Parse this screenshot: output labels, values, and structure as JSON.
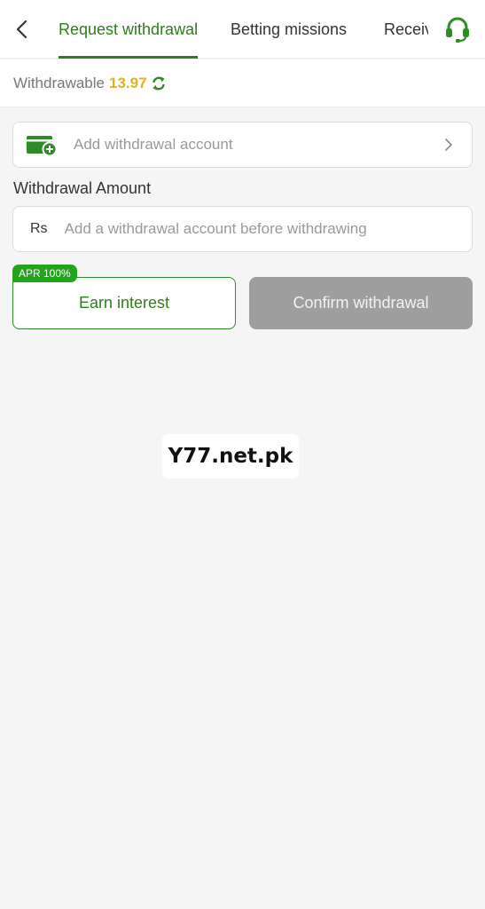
{
  "header": {
    "tabs": [
      {
        "label": "Request withdrawal",
        "active": true
      },
      {
        "label": "Betting missions",
        "active": false
      },
      {
        "label": "Receiv",
        "active": false
      }
    ]
  },
  "balance": {
    "label": "Withdrawable",
    "value": "13.97"
  },
  "account": {
    "label": "Add withdrawal account"
  },
  "amount": {
    "title": "Withdrawal Amount",
    "currency": "Rs",
    "placeholder": "Add a withdrawal account before withdrawing",
    "value": ""
  },
  "actions": {
    "apr_badge": "APR 100%",
    "earn_label": "Earn interest",
    "confirm_label": "Confirm withdrawal"
  },
  "watermark": {
    "text": "Y77.net.pk"
  },
  "colors": {
    "brand_green": "#2e7d1e",
    "badge_green": "#22a51c",
    "balance_gold": "#e0b020",
    "disabled_gray": "#9e9e9e",
    "background": "#f5f5f5"
  },
  "icons": {
    "back": "chevron-left-icon",
    "support": "headset-icon",
    "refresh": "refresh-icon",
    "wallet": "wallet-add-icon",
    "chevron": "chevron-right-icon"
  }
}
